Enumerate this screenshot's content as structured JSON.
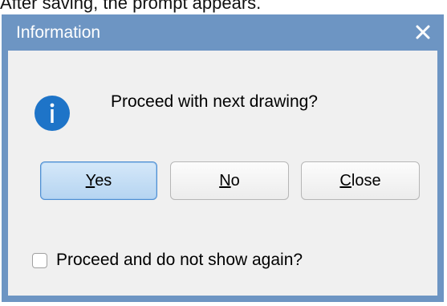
{
  "caption": "After saving, the prompt appears.",
  "dialog": {
    "title": "Information",
    "close_icon": "close-x-icon",
    "info_icon": "info-icon",
    "message": "Proceed with next drawing?",
    "buttons": {
      "yes": "Yes",
      "no": "No",
      "close": "Close"
    },
    "default_button": "yes",
    "checkbox": {
      "label": "Proceed and do not show again?",
      "checked": false
    }
  },
  "colors": {
    "frame": "#6d95c3",
    "client": "#f0f0f0",
    "info_icon": "#1e74c8",
    "default_button": "#b5d4f1"
  }
}
